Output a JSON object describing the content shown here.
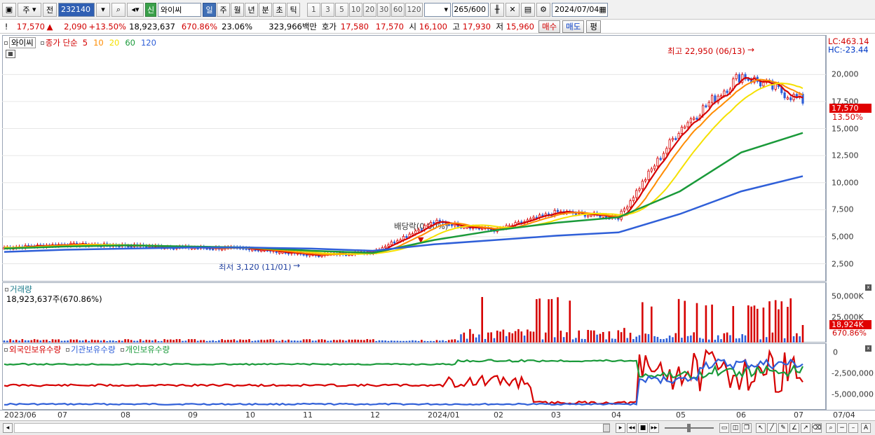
{
  "toolbar": {
    "type_label": "주",
    "jeon_label": "전",
    "code_value": "232140",
    "shin_label": "신",
    "name_value": "와이씨",
    "periods": [
      "일",
      "주",
      "월",
      "년",
      "분",
      "초",
      "틱"
    ],
    "selected_period": "일",
    "numbers": [
      "1",
      "3",
      "5",
      "10",
      "20",
      "30",
      "60",
      "120"
    ],
    "count_value": "265",
    "count_total": "/600",
    "date_value": "2024/07/04"
  },
  "quote": {
    "price": "17,570",
    "change": "2,090",
    "change_pct": "+13.50%",
    "volume": "18,923,637",
    "volume_ratio": "670.86%",
    "turnover": "23.06%",
    "amount": "323,966백만",
    "ask_label": "호가",
    "ask": "17,580",
    "bid": "17,570",
    "open_label": "시",
    "open": "16,100",
    "high_label": "고",
    "high": "17,930",
    "low_label": "저",
    "low": "15,960",
    "buy_label": "매수",
    "sell_label": "매도",
    "avg_label": "평"
  },
  "price_panel": {
    "legend_name": "와이씨",
    "legend_close": "종가 단순",
    "ma": [
      {
        "label": "5",
        "color": "#d60000"
      },
      {
        "label": "10",
        "color": "#ff8c00"
      },
      {
        "label": "20",
        "color": "#f5e000"
      },
      {
        "label": "60",
        "color": "#1a9a3a"
      },
      {
        "label": "120",
        "color": "#2f5fd8"
      }
    ],
    "high_annotation": "최고 22,950 (06/13)",
    "low_annotation": "최저 3,120 (11/01)",
    "dividend_annotation": "배당락(0.00%)",
    "lc": "LC:463.14",
    "hc": "HC:-23.44",
    "yticks": [
      "20,000",
      "17,500",
      "15,000",
      "12,500",
      "10,000",
      "7,500",
      "5,000",
      "2,500"
    ],
    "price_tag": "17,570",
    "pct_tag": "13.50%"
  },
  "volume_panel": {
    "title": "거래량",
    "value": "18,923,637주(670.86%)",
    "yticks": [
      "50,000K",
      "25,000K"
    ],
    "tag": "18,924K",
    "tag_pct": "670.86%"
  },
  "holding_panel": {
    "series": [
      {
        "label": "외국인보유수량",
        "color": "#d60000"
      },
      {
        "label": "기관보유수량",
        "color": "#2f5fd8"
      },
      {
        "label": "개인보유수량",
        "color": "#1a9a3a"
      }
    ],
    "yticks": [
      "0",
      "-2,500,000",
      "-5,000,000"
    ]
  },
  "xaxis": [
    "2023/06",
    "07",
    "08",
    "09",
    "10",
    "11",
    "12",
    "2024/01",
    "02",
    "03",
    "04",
    "05",
    "06",
    "07",
    "07/04"
  ],
  "chart_data": {
    "type": "line",
    "x": [
      "2023/06",
      "07",
      "08",
      "09",
      "10",
      "11",
      "12",
      "2024/01",
      "02",
      "03",
      "04",
      "05",
      "06",
      "07"
    ],
    "series": [
      {
        "name": "종가",
        "values": [
          4000,
          4300,
          4200,
          4000,
          3900,
          3300,
          3600,
          6400,
          5600,
          7300,
          6800,
          15000,
          20000,
          17570
        ]
      },
      {
        "name": "60",
        "values": [
          3900,
          4100,
          4200,
          4100,
          4000,
          3700,
          3500,
          4700,
          5600,
          6300,
          6800,
          9200,
          12800,
          14600
        ]
      },
      {
        "name": "120",
        "values": [
          3600,
          3800,
          3900,
          4000,
          4000,
          3900,
          3700,
          4300,
          4700,
          5100,
          5400,
          7100,
          9200,
          10600
        ]
      }
    ],
    "ylim": [
      1500,
      23000
    ]
  }
}
